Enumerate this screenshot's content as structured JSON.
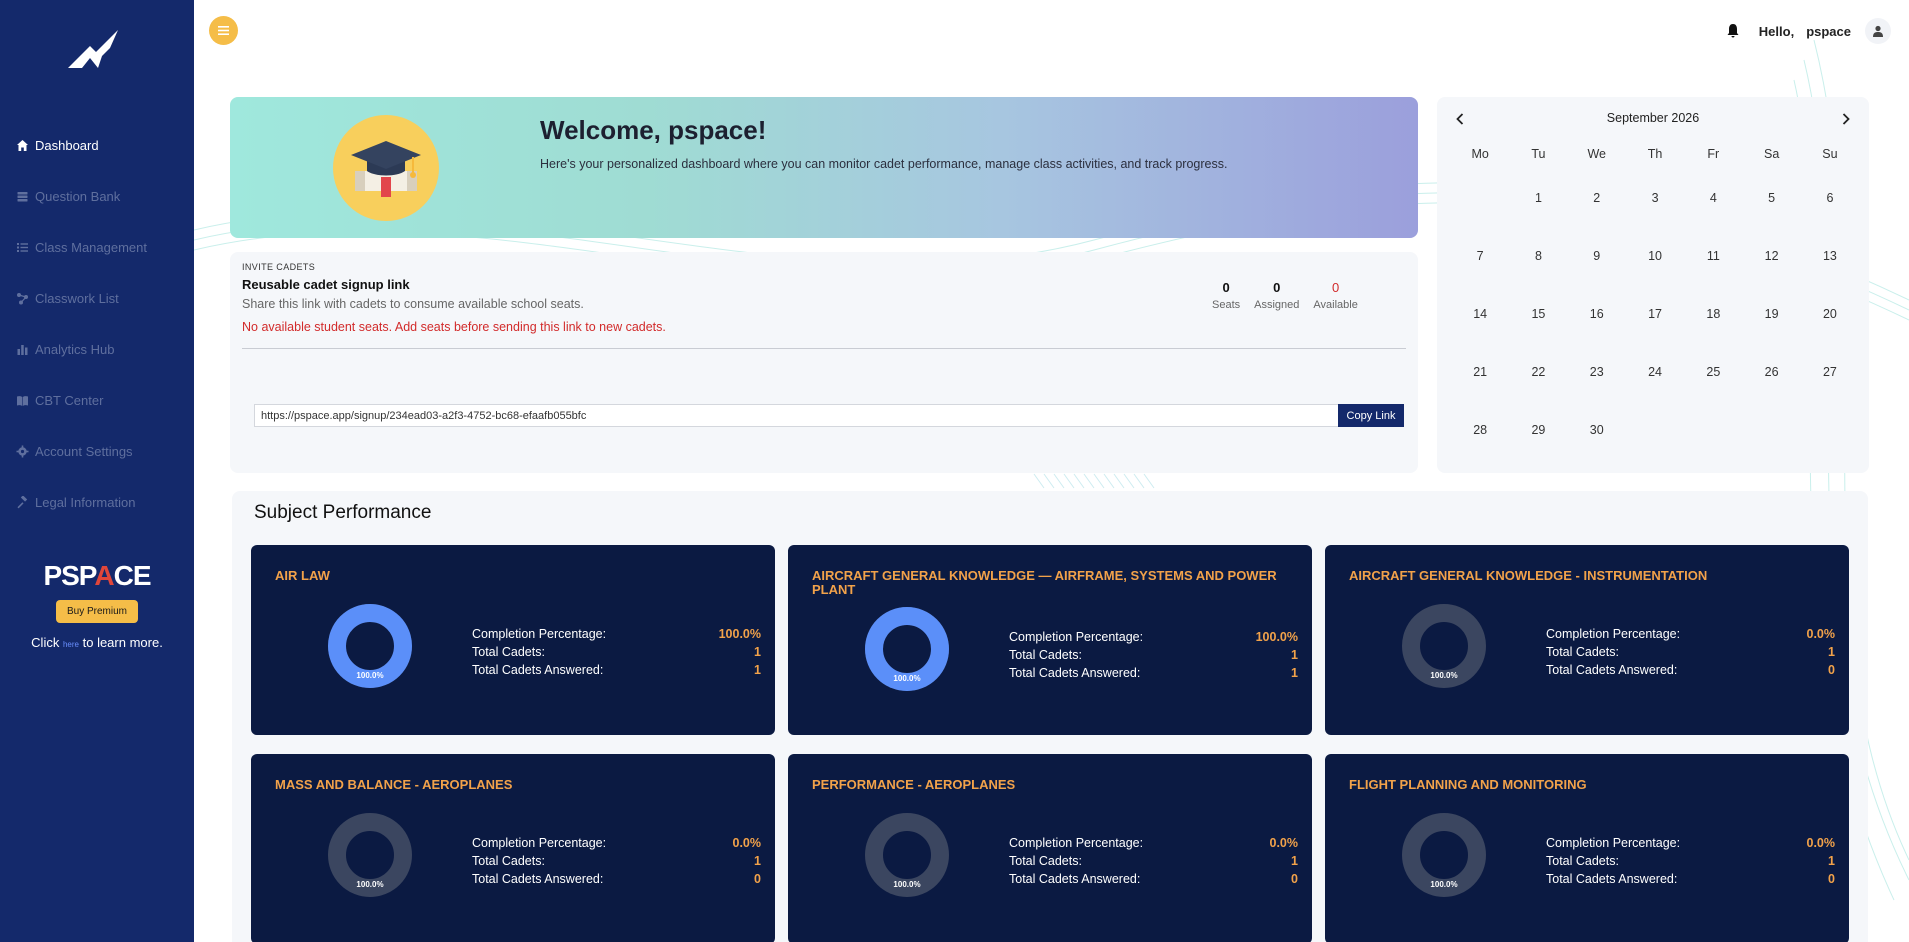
{
  "sidebar": {
    "nav": [
      {
        "label": "Dashboard",
        "icon": "home-icon",
        "active": true
      },
      {
        "label": "Question Bank",
        "icon": "database-icon",
        "active": false
      },
      {
        "label": "Class Management",
        "icon": "list-icon",
        "active": false
      },
      {
        "label": "Classwork List",
        "icon": "share-icon",
        "active": false
      },
      {
        "label": "Analytics Hub",
        "icon": "bar-chart-icon",
        "active": false
      },
      {
        "label": "CBT Center",
        "icon": "book-icon",
        "active": false
      },
      {
        "label": "Account Settings",
        "icon": "gear-icon",
        "active": false
      },
      {
        "label": "Legal Information",
        "icon": "gavel-icon",
        "active": false
      }
    ],
    "promo": {
      "brand_a": "PSP",
      "brand_b": "A",
      "brand_c": "CE",
      "button": "Buy Premium",
      "learn_pre": "Click",
      "learn_link": "here",
      "learn_post": "to learn more."
    }
  },
  "header": {
    "hello": "Hello,",
    "username": "pspace"
  },
  "welcome": {
    "title": "Welcome, pspace!",
    "subtitle": "Here's your personalized dashboard where you can monitor cadet performance, manage class activities, and track progress."
  },
  "invite": {
    "tag": "INVITE CADETS",
    "title": "Reusable cadet signup link",
    "subtitle": "Share this link with cadets to consume available school seats.",
    "warning": "No available student seats. Add seats before sending this link to new cadets.",
    "stats": [
      {
        "value": "0",
        "label": "Seats"
      },
      {
        "value": "0",
        "label": "Assigned"
      },
      {
        "value": "0",
        "label": "Available"
      }
    ],
    "link": "https://pspace.app/signup/234ead03-a2f3-4752-bc68-efaafb055bfc",
    "copy_label": "Copy Link"
  },
  "calendar": {
    "title": "September 2026",
    "weekdays": [
      "Mo",
      "Tu",
      "We",
      "Th",
      "Fr",
      "Sa",
      "Su"
    ],
    "leading_blanks": 1,
    "days": 30
  },
  "subjects": {
    "title": "Subject Performance",
    "labels": {
      "completion": "Completion Percentage:",
      "total": "Total Cadets:",
      "answered": "Total Cadets Answered:"
    },
    "cards": [
      {
        "title": "AIR LAW",
        "completion": "100.0%",
        "fraction": 1.0,
        "total": "1",
        "answered": "1",
        "donut_label": "100.0%"
      },
      {
        "title": "AIRCRAFT GENERAL KNOWLEDGE — AIRFRAME, SYSTEMS AND POWER PLANT",
        "completion": "100.0%",
        "fraction": 1.0,
        "total": "1",
        "answered": "1",
        "donut_label": "100.0%"
      },
      {
        "title": "AIRCRAFT GENERAL KNOWLEDGE - INSTRUMENTATION",
        "completion": "0.0%",
        "fraction": 0.0,
        "total": "1",
        "answered": "0",
        "donut_label": "100.0%"
      },
      {
        "title": "MASS AND BALANCE - AEROPLANES",
        "completion": "0.0%",
        "fraction": 0.0,
        "total": "1",
        "answered": "0",
        "donut_label": "100.0%"
      },
      {
        "title": "PERFORMANCE - AEROPLANES",
        "completion": "0.0%",
        "fraction": 0.0,
        "total": "1",
        "answered": "0",
        "donut_label": "100.0%"
      },
      {
        "title": "FLIGHT PLANNING AND MONITORING",
        "completion": "0.0%",
        "fraction": 0.0,
        "total": "1",
        "answered": "0",
        "donut_label": "100.0%"
      }
    ]
  },
  "colors": {
    "sidebar": "#14296b",
    "accent": "#f5bd48",
    "card": "#0b1a42",
    "donut_fill": "#5b8ff9",
    "donut_empty": "#3b4660",
    "warning": "#d22b2b"
  }
}
